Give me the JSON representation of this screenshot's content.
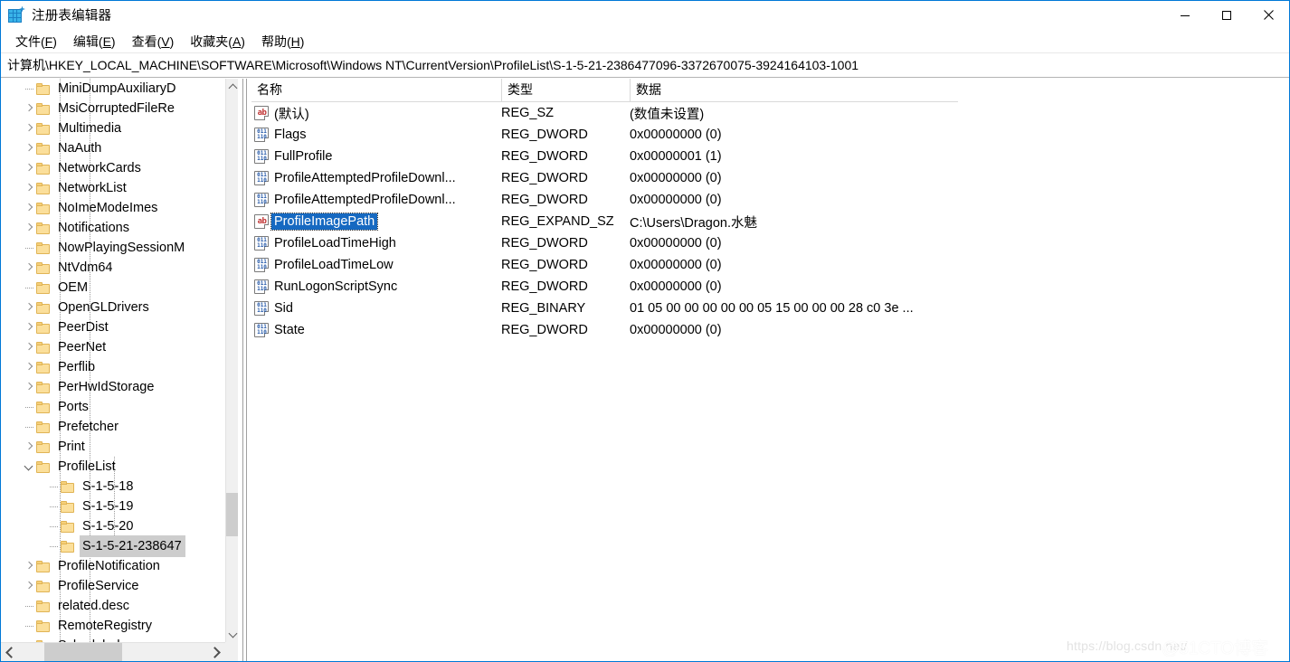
{
  "window": {
    "title": "注册表编辑器",
    "icon": "registry-editor-icon",
    "minimize_label": "—",
    "maximize_label": "□",
    "close_label": "✕"
  },
  "menubar": {
    "items": [
      {
        "label": "文件(F)",
        "text": "文件(",
        "key": "F",
        "tail": ")"
      },
      {
        "label": "编辑(E)",
        "text": "编辑(",
        "key": "E",
        "tail": ")"
      },
      {
        "label": "查看(V)",
        "text": "查看(",
        "key": "V",
        "tail": ")"
      },
      {
        "label": "收藏夹(A)",
        "text": "收藏夹(",
        "key": "A",
        "tail": ")"
      },
      {
        "label": "帮助(H)",
        "text": "帮助(",
        "key": "H",
        "tail": ")"
      }
    ]
  },
  "address": {
    "path": "计算机\\HKEY_LOCAL_MACHINE\\SOFTWARE\\Microsoft\\Windows NT\\CurrentVersion\\ProfileList\\S-1-5-21-2386477096-3372670075-3924164103-1001"
  },
  "tree": {
    "items": [
      {
        "label": "MiniDumpAuxiliaryD",
        "indent": 1,
        "expander": "none",
        "selected": false
      },
      {
        "label": "MsiCorruptedFileRe",
        "indent": 1,
        "expander": "closed",
        "selected": false
      },
      {
        "label": "Multimedia",
        "indent": 1,
        "expander": "closed",
        "selected": false
      },
      {
        "label": "NaAuth",
        "indent": 1,
        "expander": "closed",
        "selected": false
      },
      {
        "label": "NetworkCards",
        "indent": 1,
        "expander": "closed",
        "selected": false
      },
      {
        "label": "NetworkList",
        "indent": 1,
        "expander": "closed",
        "selected": false
      },
      {
        "label": "NoImeModeImes",
        "indent": 1,
        "expander": "closed",
        "selected": false
      },
      {
        "label": "Notifications",
        "indent": 1,
        "expander": "closed",
        "selected": false
      },
      {
        "label": "NowPlayingSessionM",
        "indent": 1,
        "expander": "none",
        "selected": false
      },
      {
        "label": "NtVdm64",
        "indent": 1,
        "expander": "closed",
        "selected": false
      },
      {
        "label": "OEM",
        "indent": 1,
        "expander": "none",
        "selected": false
      },
      {
        "label": "OpenGLDrivers",
        "indent": 1,
        "expander": "closed",
        "selected": false
      },
      {
        "label": "PeerDist",
        "indent": 1,
        "expander": "closed",
        "selected": false
      },
      {
        "label": "PeerNet",
        "indent": 1,
        "expander": "closed",
        "selected": false
      },
      {
        "label": "Perflib",
        "indent": 1,
        "expander": "closed",
        "selected": false
      },
      {
        "label": "PerHwIdStorage",
        "indent": 1,
        "expander": "closed",
        "selected": false
      },
      {
        "label": "Ports",
        "indent": 1,
        "expander": "none",
        "selected": false
      },
      {
        "label": "Prefetcher",
        "indent": 1,
        "expander": "none",
        "selected": false
      },
      {
        "label": "Print",
        "indent": 1,
        "expander": "closed",
        "selected": false
      },
      {
        "label": "ProfileList",
        "indent": 1,
        "expander": "open",
        "selected": false
      },
      {
        "label": "S-1-5-18",
        "indent": 2,
        "expander": "none",
        "selected": false
      },
      {
        "label": "S-1-5-19",
        "indent": 2,
        "expander": "none",
        "selected": false
      },
      {
        "label": "S-1-5-20",
        "indent": 2,
        "expander": "none",
        "selected": false
      },
      {
        "label": "S-1-5-21-238647",
        "indent": 2,
        "expander": "none",
        "selected": true
      },
      {
        "label": "ProfileNotification",
        "indent": 1,
        "expander": "closed",
        "selected": false
      },
      {
        "label": "ProfileService",
        "indent": 1,
        "expander": "closed",
        "selected": false
      },
      {
        "label": "related.desc",
        "indent": 1,
        "expander": "none",
        "selected": false
      },
      {
        "label": "RemoteRegistry",
        "indent": 1,
        "expander": "none",
        "selected": false
      },
      {
        "label": "Scheduled",
        "indent": 1,
        "expander": "none",
        "selected": false
      }
    ]
  },
  "list": {
    "columns": [
      {
        "label": "名称",
        "key": "name"
      },
      {
        "label": "类型",
        "key": "type"
      },
      {
        "label": "数据",
        "key": "data"
      }
    ],
    "rows": [
      {
        "name": "(默认)",
        "type": "REG_SZ",
        "data": "(数值未设置)",
        "icon": "string-value-icon",
        "selected": false
      },
      {
        "name": "Flags",
        "type": "REG_DWORD",
        "data": "0x00000000 (0)",
        "icon": "binary-value-icon",
        "selected": false
      },
      {
        "name": "FullProfile",
        "type": "REG_DWORD",
        "data": "0x00000001 (1)",
        "icon": "binary-value-icon",
        "selected": false
      },
      {
        "name": "ProfileAttemptedProfileDownl...",
        "type": "REG_DWORD",
        "data": "0x00000000 (0)",
        "icon": "binary-value-icon",
        "selected": false
      },
      {
        "name": "ProfileAttemptedProfileDownl...",
        "type": "REG_DWORD",
        "data": "0x00000000 (0)",
        "icon": "binary-value-icon",
        "selected": false
      },
      {
        "name": "ProfileImagePath",
        "type": "REG_EXPAND_SZ",
        "data": "C:\\Users\\Dragon.水魅",
        "icon": "string-value-icon",
        "selected": true
      },
      {
        "name": "ProfileLoadTimeHigh",
        "type": "REG_DWORD",
        "data": "0x00000000 (0)",
        "icon": "binary-value-icon",
        "selected": false
      },
      {
        "name": "ProfileLoadTimeLow",
        "type": "REG_DWORD",
        "data": "0x00000000 (0)",
        "icon": "binary-value-icon",
        "selected": false
      },
      {
        "name": "RunLogonScriptSync",
        "type": "REG_DWORD",
        "data": "0x00000000 (0)",
        "icon": "binary-value-icon",
        "selected": false
      },
      {
        "name": "Sid",
        "type": "REG_BINARY",
        "data": "01 05 00 00 00 00 00 05 15 00 00 00 28 c0 3e ...",
        "icon": "binary-value-icon",
        "selected": false
      },
      {
        "name": "State",
        "type": "REG_DWORD",
        "data": "0x00000000 (0)",
        "icon": "binary-value-icon",
        "selected": false
      }
    ]
  },
  "watermarks": {
    "csdn": "https://blog.csdn.net/",
    "cto": "@51CTO博客"
  },
  "colors": {
    "selection_blue": "#1669c1",
    "selection_gray": "#cdcdcd",
    "window_border": "#0078d7",
    "folder_yellow": "#fbdf9b"
  }
}
